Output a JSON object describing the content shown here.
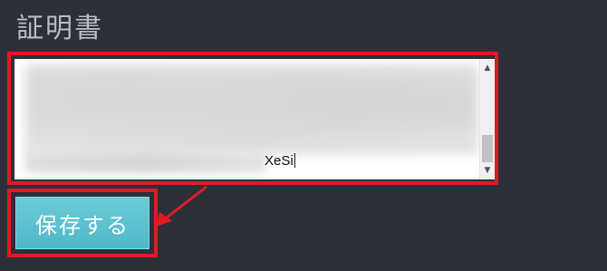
{
  "section": {
    "title": "証明書"
  },
  "textarea": {
    "visible_text": "XeSi"
  },
  "buttons": {
    "save_label": "保存する"
  },
  "icons": {
    "scroll_up": "scroll-up-arrow",
    "scroll_down": "scroll-down-arrow"
  },
  "colors": {
    "background": "#2d3039",
    "highlight": "#e01b24",
    "button": "#56bccb"
  }
}
